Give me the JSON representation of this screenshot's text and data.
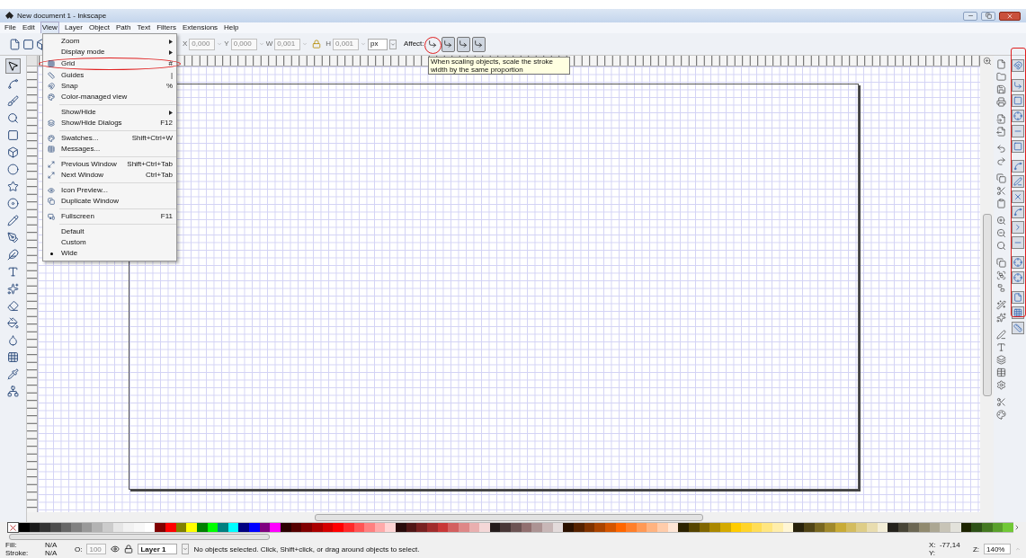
{
  "window": {
    "title": "New document 1 - Inkscape"
  },
  "menu_bar": [
    {
      "label": "File",
      "selected": false
    },
    {
      "label": "Edit",
      "selected": false
    },
    {
      "label": "View",
      "selected": true
    },
    {
      "label": "Layer",
      "selected": false
    },
    {
      "label": "Object",
      "selected": false
    },
    {
      "label": "Path",
      "selected": false
    },
    {
      "label": "Text",
      "selected": false
    },
    {
      "label": "Filters",
      "selected": false
    },
    {
      "label": "Extensions",
      "selected": false
    },
    {
      "label": "Help",
      "selected": false
    }
  ],
  "toolbar": {
    "fields": [
      {
        "label": "X",
        "value": "0,000"
      },
      {
        "label": "Y",
        "value": "0,000"
      },
      {
        "label": "W",
        "value": "0,001"
      },
      {
        "label": "H",
        "value": "0,001"
      }
    ],
    "unit": "px",
    "affect_label": "Affect:"
  },
  "tooltip": "When scaling objects, scale the stroke width by the same proportion",
  "view_menu": [
    {
      "kind": "submenu",
      "label": "Zoom"
    },
    {
      "kind": "submenu",
      "label": "Display mode"
    },
    {
      "kind": "item",
      "label": "Grid",
      "shortcut": "#",
      "circled": true
    },
    {
      "kind": "item",
      "label": "Guides",
      "shortcut": "|"
    },
    {
      "kind": "item",
      "label": "Snap",
      "shortcut": "%"
    },
    {
      "kind": "item",
      "label": "Color-managed view"
    },
    {
      "kind": "separator"
    },
    {
      "kind": "submenu",
      "label": "Show/Hide"
    },
    {
      "kind": "item",
      "label": "Show/Hide Dialogs",
      "shortcut": "F12"
    },
    {
      "kind": "separator"
    },
    {
      "kind": "item",
      "label": "Swatches...",
      "shortcut": "Shift+Ctrl+W"
    },
    {
      "kind": "item",
      "label": "Messages..."
    },
    {
      "kind": "separator"
    },
    {
      "kind": "item",
      "label": "Previous Window",
      "shortcut": "Shift+Ctrl+Tab"
    },
    {
      "kind": "item",
      "label": "Next Window",
      "shortcut": "Ctrl+Tab"
    },
    {
      "kind": "separator"
    },
    {
      "kind": "item",
      "label": "Icon Preview..."
    },
    {
      "kind": "item",
      "label": "Duplicate Window"
    },
    {
      "kind": "separator"
    },
    {
      "kind": "item",
      "label": "Fullscreen",
      "shortcut": "F11"
    },
    {
      "kind": "separator"
    },
    {
      "kind": "radio",
      "label": "Default",
      "selected": false
    },
    {
      "kind": "radio",
      "label": "Custom",
      "selected": false
    },
    {
      "kind": "radio",
      "label": "Wide",
      "selected": true
    }
  ],
  "palette": [
    {
      "color": "#000000"
    },
    {
      "color": "#1a1a1a"
    },
    {
      "color": "#333333"
    },
    {
      "color": "#4d4d4d"
    },
    {
      "color": "#666666"
    },
    {
      "color": "#808080"
    },
    {
      "color": "#999999"
    },
    {
      "color": "#b3b3b3"
    },
    {
      "color": "#cccccc"
    },
    {
      "color": "#e6e6e6"
    },
    {
      "color": "#f2f2f2"
    },
    {
      "color": "#f8f8f8"
    },
    {
      "color": "#ffffff"
    },
    {
      "color": "#800000"
    },
    {
      "color": "#ff0000"
    },
    {
      "color": "#808000"
    },
    {
      "color": "#ffff00"
    },
    {
      "color": "#008000"
    },
    {
      "color": "#00ff00"
    },
    {
      "color": "#008080"
    },
    {
      "color": "#00ffff"
    },
    {
      "color": "#000080"
    },
    {
      "color": "#0000ff"
    },
    {
      "color": "#800080"
    },
    {
      "color": "#ff00ff"
    },
    {
      "color": "#2b0000"
    },
    {
      "color": "#550000"
    },
    {
      "color": "#800001"
    },
    {
      "color": "#aa0000"
    },
    {
      "color": "#d40000"
    },
    {
      "color": "#ff0001"
    },
    {
      "color": "#ff2a2a"
    },
    {
      "color": "#ff5555"
    },
    {
      "color": "#ff8080"
    },
    {
      "color": "#ffaaaa"
    },
    {
      "color": "#ffd5d5"
    },
    {
      "color": "#280b0b"
    },
    {
      "color": "#501616"
    },
    {
      "color": "#782121"
    },
    {
      "color": "#a02c2c"
    },
    {
      "color": "#c83737"
    },
    {
      "color": "#d35f5f"
    },
    {
      "color": "#de8787"
    },
    {
      "color": "#e9afaf"
    },
    {
      "color": "#f4d7d7"
    },
    {
      "color": "#241c1c"
    },
    {
      "color": "#483737"
    },
    {
      "color": "#6c5353"
    },
    {
      "color": "#916f6f"
    },
    {
      "color": "#ac9393"
    },
    {
      "color": "#c8b7b7"
    },
    {
      "color": "#e3dbdb"
    },
    {
      "color": "#2b1100"
    },
    {
      "color": "#552200"
    },
    {
      "color": "#803300"
    },
    {
      "color": "#aa4400"
    },
    {
      "color": "#d45500"
    },
    {
      "color": "#ff6600"
    },
    {
      "color": "#ff7f2a"
    },
    {
      "color": "#ff9955"
    },
    {
      "color": "#ffb380"
    },
    {
      "color": "#ffccaa"
    },
    {
      "color": "#ffe6d5"
    },
    {
      "color": "#2b2200"
    },
    {
      "color": "#554400"
    },
    {
      "color": "#806600"
    },
    {
      "color": "#aa8800"
    },
    {
      "color": "#d4aa00"
    },
    {
      "color": "#ffcc00"
    },
    {
      "color": "#ffd42a"
    },
    {
      "color": "#ffdd55"
    },
    {
      "color": "#ffe680"
    },
    {
      "color": "#ffeeaa"
    },
    {
      "color": "#fff6d5"
    },
    {
      "color": "#28220b"
    },
    {
      "color": "#504416"
    },
    {
      "color": "#786721"
    },
    {
      "color": "#a0892c"
    },
    {
      "color": "#c8ab37"
    },
    {
      "color": "#d3bc5f"
    },
    {
      "color": "#decd87"
    },
    {
      "color": "#e9ddaf"
    },
    {
      "color": "#f4eed7"
    },
    {
      "color": "#24221c"
    },
    {
      "color": "#484537"
    },
    {
      "color": "#6c6753"
    },
    {
      "color": "#918a6f"
    },
    {
      "color": "#aca793"
    },
    {
      "color": "#c8c4b7"
    },
    {
      "color": "#e3e2db"
    },
    {
      "color": "#1c2400"
    },
    {
      "color": "#2d5016"
    },
    {
      "color": "#447821"
    },
    {
      "color": "#5aa02c"
    },
    {
      "color": "#71c837"
    }
  ],
  "status_bar": {
    "fill_label": "Fill:",
    "fill_value": "N/A",
    "stroke_label": "Stroke:",
    "stroke_value": "N/A",
    "opacity_label": "O:",
    "opacity_value": "100",
    "layer": "Layer 1",
    "message": "No objects selected. Click, Shift+click, or drag around objects to select.",
    "x_label": "X:",
    "x_value": "-77,14",
    "y_label": "Y:",
    "zoom_label": "Z:",
    "zoom_value": "140%"
  }
}
